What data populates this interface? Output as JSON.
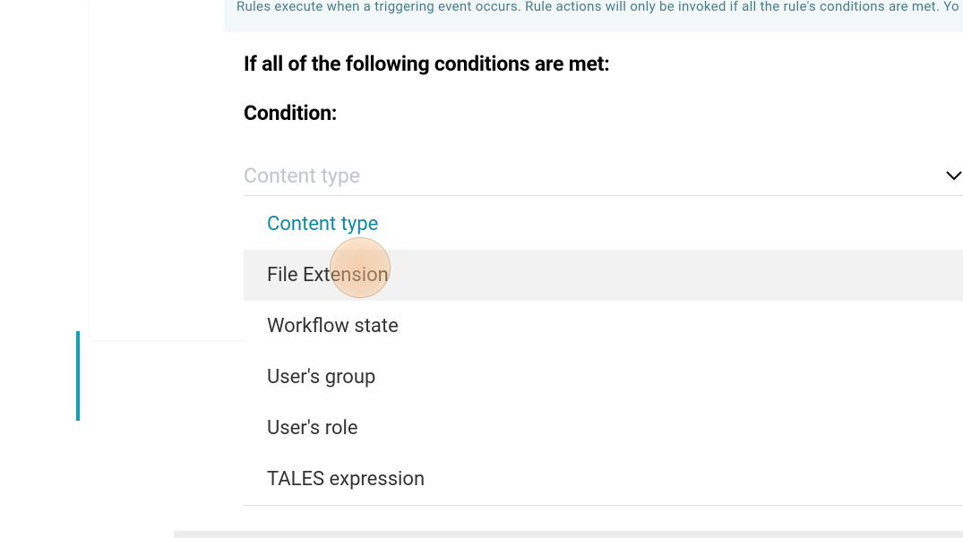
{
  "banner": {
    "text": "Rules execute when a triggering event occurs. Rule actions will only be invoked if all the rule's conditions are met. Yo"
  },
  "headings": {
    "conditions_intro": "If all of the following conditions are met:",
    "condition_label": "Condition:"
  },
  "dropdown": {
    "selected_value": "Content type",
    "options": [
      {
        "label": "Content type",
        "selected": true,
        "hovered": false
      },
      {
        "label": "File Extension",
        "selected": false,
        "hovered": true
      },
      {
        "label": "Workflow state",
        "selected": false,
        "hovered": false
      },
      {
        "label": "User's group",
        "selected": false,
        "hovered": false
      },
      {
        "label": "User's role",
        "selected": false,
        "hovered": false
      },
      {
        "label": "TALES expression",
        "selected": false,
        "hovered": false
      }
    ]
  },
  "colors": {
    "accent": "#0a8aa8",
    "banner_bg": "#f2f8fa",
    "banner_text": "#4a7d8c",
    "placeholder": "#c0c4c7",
    "hover_bg": "#f2f2f2"
  }
}
